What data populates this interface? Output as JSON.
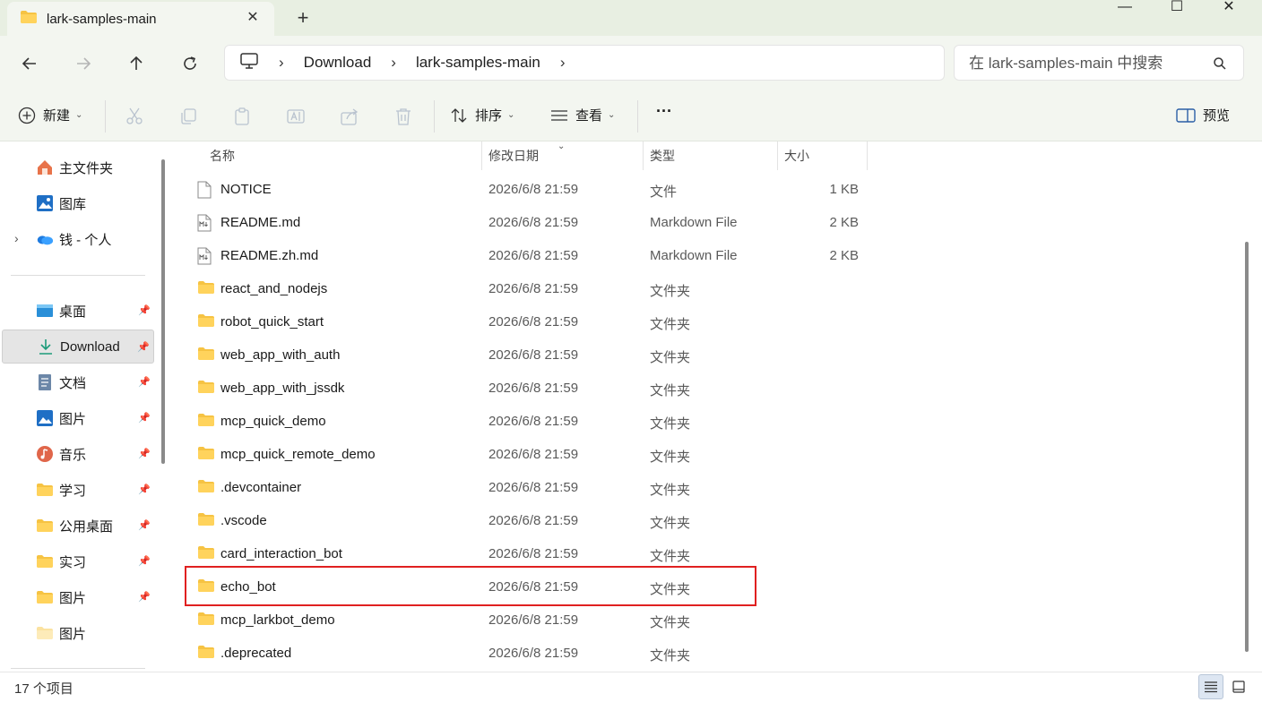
{
  "window": {
    "tab_title": "lark-samples-main",
    "new_tab": "+",
    "close_tab": "✕",
    "minimize": "—",
    "maximize": "☐",
    "close": "✕"
  },
  "nav": {
    "breadcrumbs": [
      "Download",
      "lark-samples-main"
    ],
    "search_placeholder": "在 lark-samples-main 中搜索"
  },
  "commands": {
    "new_label": "新建",
    "sort_label": "排序",
    "view_label": "查看",
    "more_label": "···",
    "preview_label": "预览"
  },
  "sidebar": {
    "items": [
      {
        "label": "主文件夹",
        "icon": "home-icon"
      },
      {
        "label": "图库",
        "icon": "gallery-icon"
      },
      {
        "label": "钱 - 个人",
        "icon": "onedrive-cloud-icon"
      },
      {
        "label": "桌面",
        "icon": "desktop-icon",
        "pinned": true
      },
      {
        "label": "Download",
        "icon": "download-icon",
        "pinned": true,
        "selected": true
      },
      {
        "label": "文档",
        "icon": "documents-icon",
        "pinned": true
      },
      {
        "label": "图片",
        "icon": "pictures-icon",
        "pinned": true
      },
      {
        "label": "音乐",
        "icon": "music-icon",
        "pinned": true
      },
      {
        "label": "学习",
        "icon": "folder-icon",
        "pinned": true
      },
      {
        "label": "公用桌面",
        "icon": "folder-icon",
        "pinned": true
      },
      {
        "label": "实习",
        "icon": "folder-icon",
        "pinned": true
      },
      {
        "label": "图片",
        "icon": "folder-icon",
        "pinned": true
      },
      {
        "label": "图片",
        "icon": "folder-icon",
        "pinned": false
      }
    ]
  },
  "files": {
    "columns": [
      "名称",
      "修改日期",
      "类型",
      "大小"
    ],
    "rows": [
      {
        "name": "NOTICE",
        "date": "2026/6/8 21:59",
        "type": "文件",
        "size": "1 KB",
        "icon": "file-icon"
      },
      {
        "name": "README.md",
        "date": "2026/6/8 21:59",
        "type": "Markdown File",
        "size": "2 KB",
        "icon": "markdown-file-icon"
      },
      {
        "name": "README.zh.md",
        "date": "2026/6/8 21:59",
        "type": "Markdown File",
        "size": "2 KB",
        "icon": "markdown-file-icon"
      },
      {
        "name": "react_and_nodejs",
        "date": "2026/6/8 21:59",
        "type": "文件夹",
        "size": "",
        "icon": "folder-icon"
      },
      {
        "name": "robot_quick_start",
        "date": "2026/6/8 21:59",
        "type": "文件夹",
        "size": "",
        "icon": "folder-icon"
      },
      {
        "name": "web_app_with_auth",
        "date": "2026/6/8 21:59",
        "type": "文件夹",
        "size": "",
        "icon": "folder-icon"
      },
      {
        "name": "web_app_with_jssdk",
        "date": "2026/6/8 21:59",
        "type": "文件夹",
        "size": "",
        "icon": "folder-icon"
      },
      {
        "name": "mcp_quick_demo",
        "date": "2026/6/8 21:59",
        "type": "文件夹",
        "size": "",
        "icon": "folder-icon"
      },
      {
        "name": "mcp_quick_remote_demo",
        "date": "2026/6/8 21:59",
        "type": "文件夹",
        "size": "",
        "icon": "folder-icon"
      },
      {
        "name": ".devcontainer",
        "date": "2026/6/8 21:59",
        "type": "文件夹",
        "size": "",
        "icon": "folder-icon"
      },
      {
        "name": ".vscode",
        "date": "2026/6/8 21:59",
        "type": "文件夹",
        "size": "",
        "icon": "folder-icon"
      },
      {
        "name": "card_interaction_bot",
        "date": "2026/6/8 21:59",
        "type": "文件夹",
        "size": "",
        "icon": "folder-icon"
      },
      {
        "name": "echo_bot",
        "date": "2026/6/8 21:59",
        "type": "文件夹",
        "size": "",
        "icon": "folder-icon",
        "highlighted": true
      },
      {
        "name": "mcp_larkbot_demo",
        "date": "2026/6/8 21:59",
        "type": "文件夹",
        "size": "",
        "icon": "folder-icon"
      },
      {
        "name": ".deprecated",
        "date": "2026/6/8 21:59",
        "type": "文件夹",
        "size": "",
        "icon": "folder-icon"
      }
    ]
  },
  "status": {
    "item_count": "17 个项目"
  },
  "colors": {
    "folder": "#f6c343",
    "highlight_border": "#e02020",
    "titlebar_bg": "#e8efe2",
    "toolbar_bg": "#f3f6f0"
  }
}
